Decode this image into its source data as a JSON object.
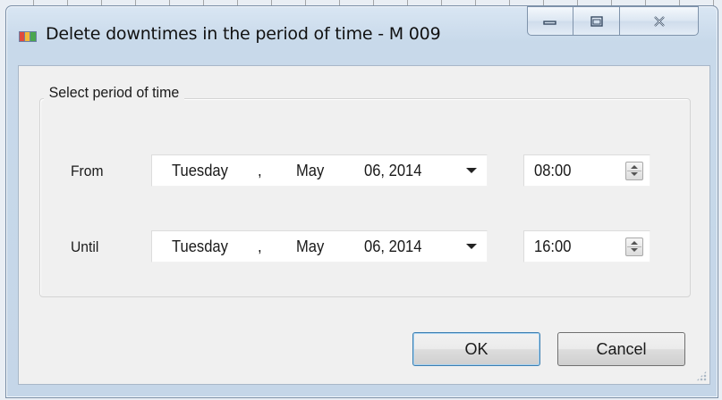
{
  "window": {
    "title": "Delete downtimes in the period of time - M 009",
    "controls": {
      "minimize": "minimize",
      "maximize": "maximize",
      "close": "close"
    }
  },
  "group": {
    "label": "Select period of time"
  },
  "from": {
    "label": "From",
    "date": {
      "weekday": "Tuesday",
      "sep": ",",
      "month": "May",
      "daymonth_year": "06, 2014"
    },
    "time": "08:00"
  },
  "until": {
    "label": "Until",
    "date": {
      "weekday": "Tuesday",
      "sep": ",",
      "month": "May",
      "daymonth_year": "06, 2014"
    },
    "time": "16:00"
  },
  "buttons": {
    "ok": "OK",
    "cancel": "Cancel"
  },
  "icons": [
    "app-icon",
    "minimize-icon",
    "maximize-icon",
    "close-icon",
    "dropdown-arrow-icon",
    "spin-up-icon",
    "spin-down-icon",
    "resize-grip-icon"
  ],
  "colors": {
    "titlebar": "#c8d9ea",
    "client": "#f0f0f0",
    "ok_border": "#3c7fb1"
  }
}
